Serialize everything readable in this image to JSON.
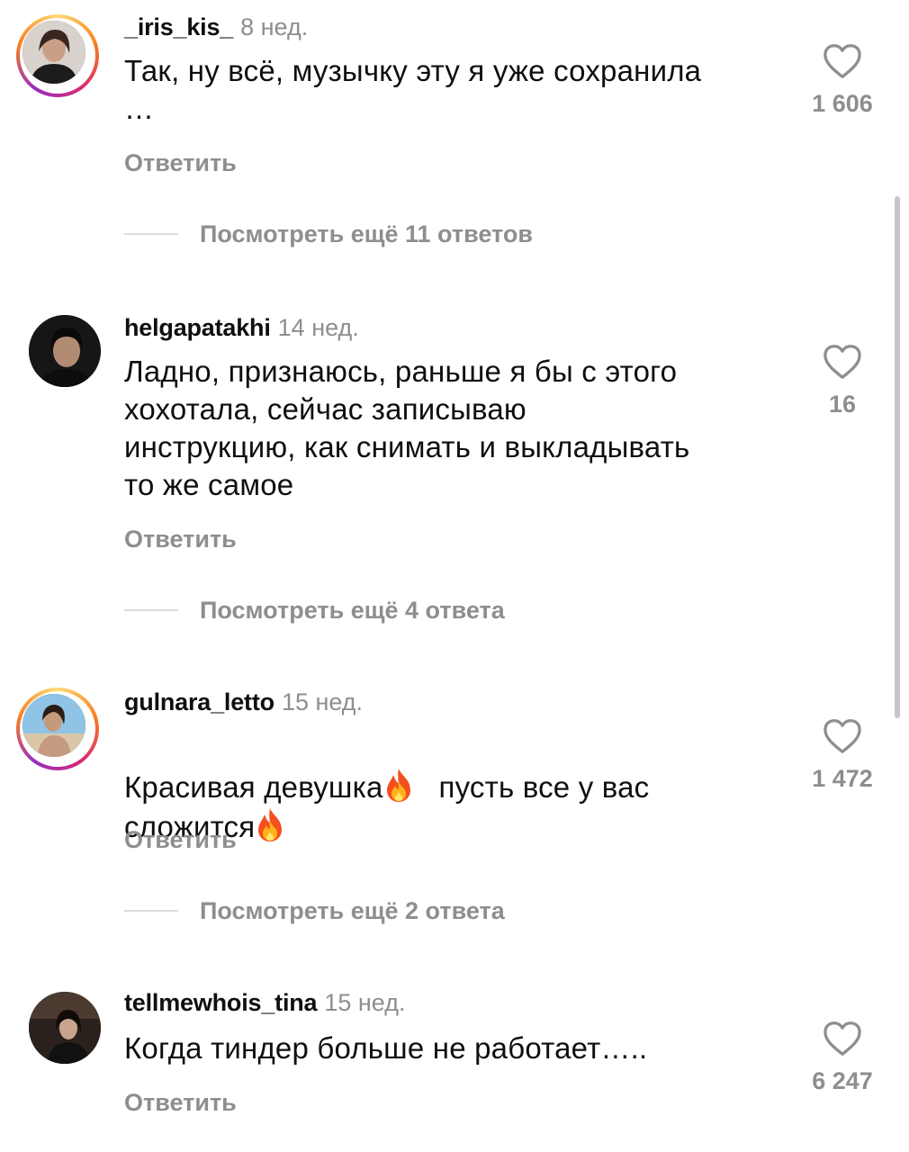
{
  "comments": [
    {
      "username": "_iris_kis_",
      "time": "8 нед.",
      "text": "Так, ну всё, музычку эту я уже сохранила\n…",
      "reply_label": "Ответить",
      "likes": "1 606",
      "more_replies": "Посмотреть ещё 11 ответов",
      "has_story_ring": true
    },
    {
      "username": "helgapatakhi",
      "time": "14 нед.",
      "text": "Ладно, признаюсь, раньше я бы с этого\nхохотала, сейчас записываю\nинструкцию, как снимать и выкладывать\nто же самое",
      "reply_label": "Ответить",
      "likes": "16",
      "more_replies": "Посмотреть ещё 4 ответа",
      "has_story_ring": false
    },
    {
      "username": "gulnara_letto",
      "time": "15 нед.",
      "text_part1": "Красивая девушка",
      "text_part2": "пусть все у вас",
      "text_part3": "сложится",
      "reply_label": "Ответить",
      "likes": "1 472",
      "more_replies": "Посмотреть ещё 2 ответа",
      "has_story_ring": true
    },
    {
      "username": "tellmewhois_tina",
      "time": "15 нед.",
      "text": "Когда тиндер больше не работает…..",
      "reply_label": "Ответить",
      "likes": "6 247",
      "has_story_ring": false
    }
  ],
  "icons": {
    "like": "heart-outline-icon",
    "emoji": "fire-emoji"
  },
  "colors": {
    "secondary_text": "#8e8e8e",
    "primary_text": "#0f0f0f",
    "story_ring": "#d62976"
  }
}
